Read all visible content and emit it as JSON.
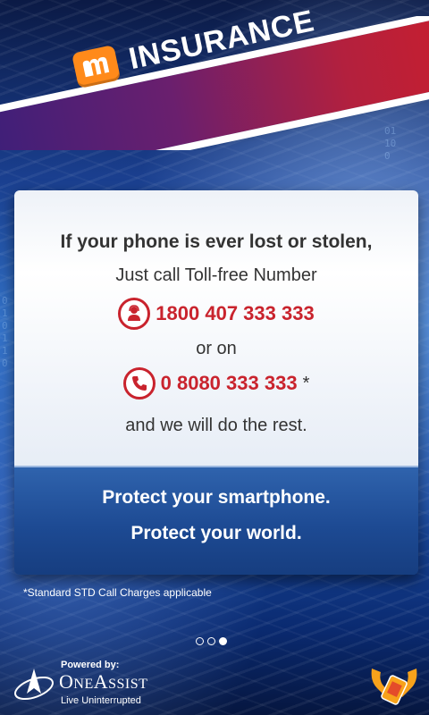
{
  "banner": {
    "title": "INSURANCE",
    "logo": "micromax-logo"
  },
  "card": {
    "headline": "If your phone is ever lost or stolen,",
    "instruction": "Just call Toll-free Number",
    "toll_free_number": "1800 407 333 333",
    "or_text": "or on",
    "alt_number": "0 8080 333 333",
    "alt_suffix": "*",
    "closing": "and we will do the rest.",
    "tagline_1": "Protect your smartphone.",
    "tagline_2": "Protect your world."
  },
  "footnote": "*Standard STD Call Charges applicable",
  "pager": {
    "count": 3,
    "active_index": 2
  },
  "footer": {
    "powered_by": "Powered by:",
    "brand": "ONEASSIST",
    "brand_display": "OneAssist",
    "brand_tagline": "Live Uninterrupted"
  },
  "colors": {
    "accent_red": "#c9232d",
    "banner_purple": "#3b1f7a",
    "banner_red": "#c91e2d",
    "card_blue": "#1d4a93",
    "logo_orange": "#ff8a1a"
  }
}
